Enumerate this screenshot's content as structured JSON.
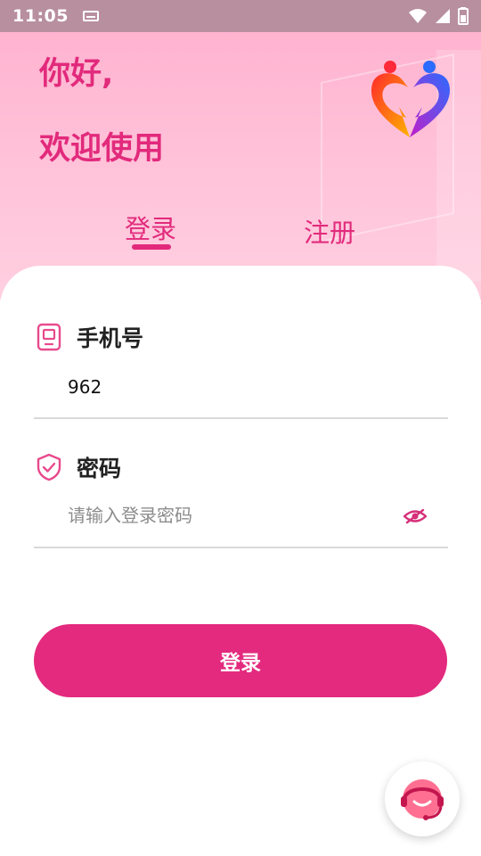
{
  "status_bar": {
    "time": "11:05",
    "icons": [
      "keyboard-icon",
      "wifi-icon",
      "signal-icon",
      "battery-icon"
    ]
  },
  "header": {
    "greeting_line1": "你好,",
    "greeting_line2": "欢迎使用",
    "logo": "heart-couple-logo"
  },
  "tabs": {
    "login": "登录",
    "register": "注册",
    "active": "login"
  },
  "form": {
    "phone_label": "手机号",
    "phone_value": "962",
    "password_label": "密码",
    "password_placeholder": "请输入登录密码",
    "submit_label": "登录"
  },
  "support": {
    "icon": "customer-service-icon"
  },
  "colors": {
    "accent": "#e22a7c",
    "button": "#e32a7e",
    "status_bar": "#b88f9f",
    "hero_top": "#ffb3d0"
  }
}
